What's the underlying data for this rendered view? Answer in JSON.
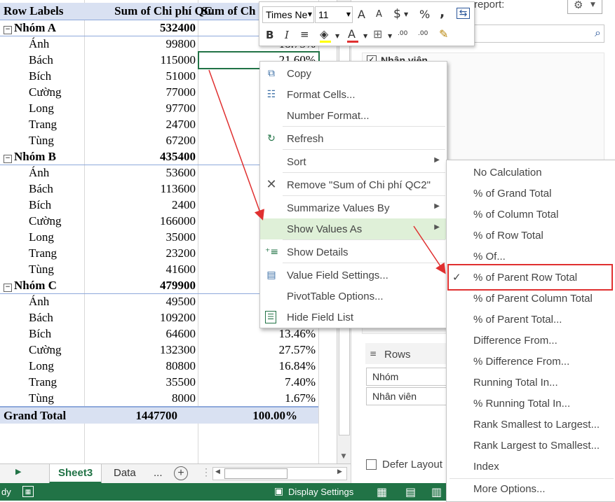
{
  "pivot": {
    "header": {
      "row_labels": "Row Labels",
      "col1": "Sum of Chi phí QC",
      "col2": "Sum of Ch"
    },
    "groups": [
      {
        "name": "Nhóm A",
        "total": "532400",
        "rows": [
          {
            "name": "Ánh",
            "v1": "99800",
            "v2": "18.75%"
          },
          {
            "name": "Bách",
            "v1": "115000",
            "v2": "21.60%"
          },
          {
            "name": "Bích",
            "v1": "51000",
            "v2": ""
          },
          {
            "name": "Cường",
            "v1": "77000",
            "v2": ""
          },
          {
            "name": "Long",
            "v1": "97700",
            "v2": ""
          },
          {
            "name": "Trang",
            "v1": "24700",
            "v2": ""
          },
          {
            "name": "Tùng",
            "v1": "67200",
            "v2": ""
          }
        ]
      },
      {
        "name": "Nhóm B",
        "total": "435400",
        "rows": [
          {
            "name": "Ánh",
            "v1": "53600",
            "v2": ""
          },
          {
            "name": "Bách",
            "v1": "113600",
            "v2": ""
          },
          {
            "name": "Bích",
            "v1": "2400",
            "v2": ""
          },
          {
            "name": "Cường",
            "v1": "166000",
            "v2": ""
          },
          {
            "name": "Long",
            "v1": "35000",
            "v2": ""
          },
          {
            "name": "Trang",
            "v1": "23200",
            "v2": ""
          },
          {
            "name": "Tùng",
            "v1": "41600",
            "v2": ""
          }
        ]
      },
      {
        "name": "Nhóm C",
        "total": "479900",
        "rows": [
          {
            "name": "Ánh",
            "v1": "49500",
            "v2": ""
          },
          {
            "name": "Bách",
            "v1": "109200",
            "v2": ""
          },
          {
            "name": "Bích",
            "v1": "64600",
            "v2": "13.46%"
          },
          {
            "name": "Cường",
            "v1": "132300",
            "v2": "27.57%"
          },
          {
            "name": "Long",
            "v1": "80800",
            "v2": "16.84%"
          },
          {
            "name": "Trang",
            "v1": "35500",
            "v2": "7.40%"
          },
          {
            "name": "Tùng",
            "v1": "8000",
            "v2": "1.67%"
          }
        ]
      }
    ],
    "grand_total": {
      "label": "Grand Total",
      "v1": "1447700",
      "v2": "100.00%"
    }
  },
  "mini_toolbar": {
    "font_name": "Times Ne",
    "font_size": "11",
    "grow_font": "A",
    "shrink_font": "A",
    "currency": "$",
    "percent": "%",
    "comma": ",",
    "bold": "B",
    "italic": "I",
    "font_color": "A",
    "inc_decimal": ".00",
    "dec_decimal": ".00"
  },
  "context_menu": {
    "items": [
      {
        "id": "copy",
        "label": "Copy"
      },
      {
        "id": "format-cells",
        "label": "Format Cells..."
      },
      {
        "id": "number-format",
        "label": "Number Format..."
      },
      {
        "id": "refresh",
        "label": "Refresh"
      },
      {
        "id": "sort",
        "label": "Sort"
      },
      {
        "id": "remove",
        "label": "Remove \"Sum of Chi phí QC2\""
      },
      {
        "id": "summarize",
        "label": "Summarize Values By"
      },
      {
        "id": "show-values",
        "label": "Show Values As"
      },
      {
        "id": "show-details",
        "label": "Show Details"
      },
      {
        "id": "value-field-settings",
        "label": "Value Field Settings..."
      },
      {
        "id": "pivottable-options",
        "label": "PivotTable Options..."
      },
      {
        "id": "hide-field-list",
        "label": "Hide Field List"
      }
    ]
  },
  "submenu": {
    "items": [
      {
        "label": "No Calculation"
      },
      {
        "label": "% of Grand Total"
      },
      {
        "label": "% of Column Total"
      },
      {
        "label": "% of Row Total"
      },
      {
        "label": "% Of..."
      },
      {
        "label": "% of Parent Row Total",
        "checked": true
      },
      {
        "label": "% of Parent Column Total"
      },
      {
        "label": "% of Parent Total..."
      },
      {
        "label": "Difference From..."
      },
      {
        "label": "% Difference From..."
      },
      {
        "label": "Running Total In..."
      },
      {
        "label": "% Running Total In..."
      },
      {
        "label": "Rank Smallest to Largest..."
      },
      {
        "label": "Rank Largest to Smallest..."
      },
      {
        "label": "Index"
      },
      {
        "label": "More Options..."
      }
    ]
  },
  "sheet_tabs": {
    "active": "Sheet3",
    "other": "Data",
    "more": "...",
    "add": "+"
  },
  "status_bar": {
    "ready": "dy",
    "display_settings": "Display Settings"
  },
  "field_pane": {
    "report_text": "report:",
    "field_item": "Nhân viên",
    "rows_label": "Rows",
    "row_fields": [
      "Nhóm",
      "Nhân viên"
    ],
    "defer_label": "Defer Layout U"
  },
  "colors": {
    "excel_green": "#217346",
    "header_fill": "#d9e1f2",
    "highlight_red": "#e03030",
    "menu_hover": "#dff0d8"
  }
}
